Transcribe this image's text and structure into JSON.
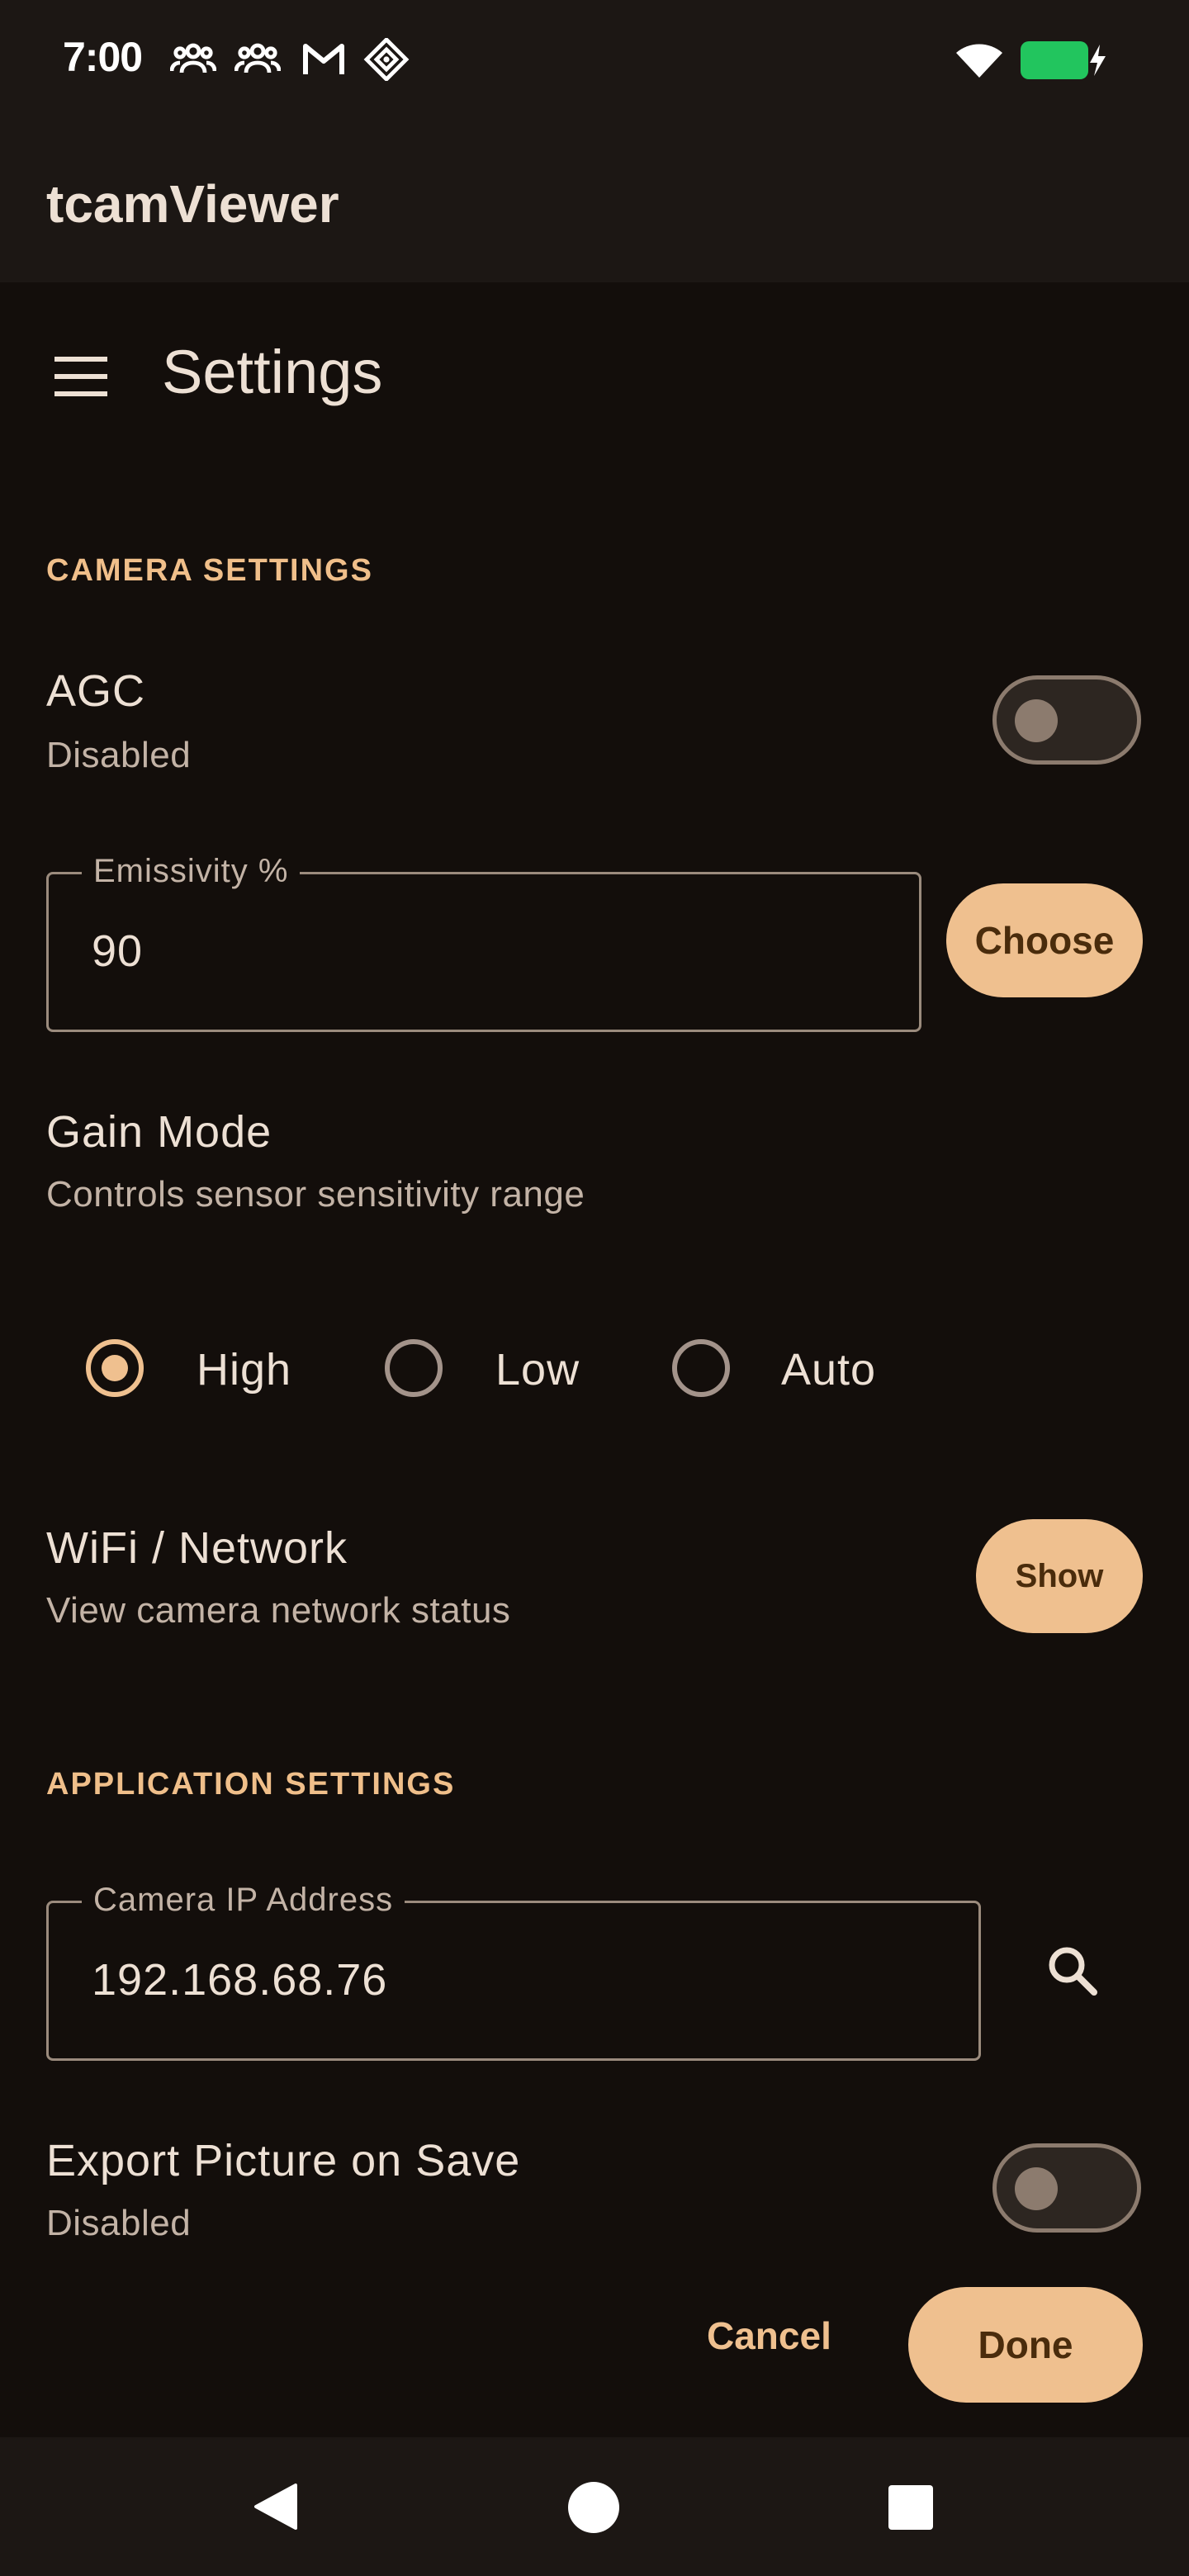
{
  "status_bar": {
    "time": "7:00",
    "icons": [
      "group-icon",
      "group-icon",
      "gmail-icon",
      "diamond-app-icon",
      "wifi-icon",
      "battery-charging-icon"
    ]
  },
  "app_bar": {
    "title": "tcamViewer"
  },
  "header": {
    "title": "Settings",
    "menu_icon": "hamburger-menu-icon"
  },
  "camera_settings": {
    "section_title": "CAMERA SETTINGS",
    "agc": {
      "title": "AGC",
      "status": "Disabled",
      "enabled": false
    },
    "emissivity": {
      "label": "Emissivity %",
      "value": "90",
      "button": "Choose"
    },
    "gain_mode": {
      "title": "Gain Mode",
      "subtitle": "Controls sensor sensitivity range",
      "options": [
        "High",
        "Low",
        "Auto"
      ],
      "selected": "High"
    },
    "wifi": {
      "title": "WiFi / Network",
      "subtitle": "View camera network status",
      "button": "Show"
    }
  },
  "application_settings": {
    "section_title": "APPLICATION SETTINGS",
    "camera_ip": {
      "label": "Camera IP Address",
      "value": "192.168.68.76",
      "icon": "search-icon"
    },
    "export_picture": {
      "title": "Export Picture on Save",
      "status": "Disabled",
      "enabled": false
    }
  },
  "dialog_actions": {
    "cancel": "Cancel",
    "done": "Done"
  },
  "nav_bar": {
    "icons": [
      "back-icon",
      "home-icon",
      "recents-icon"
    ]
  },
  "colors": {
    "background": "#130e0b",
    "surface": "#1c1714",
    "accent": "#efc08f",
    "on_accent": "#4a2c0c",
    "battery": "#22c55e"
  }
}
